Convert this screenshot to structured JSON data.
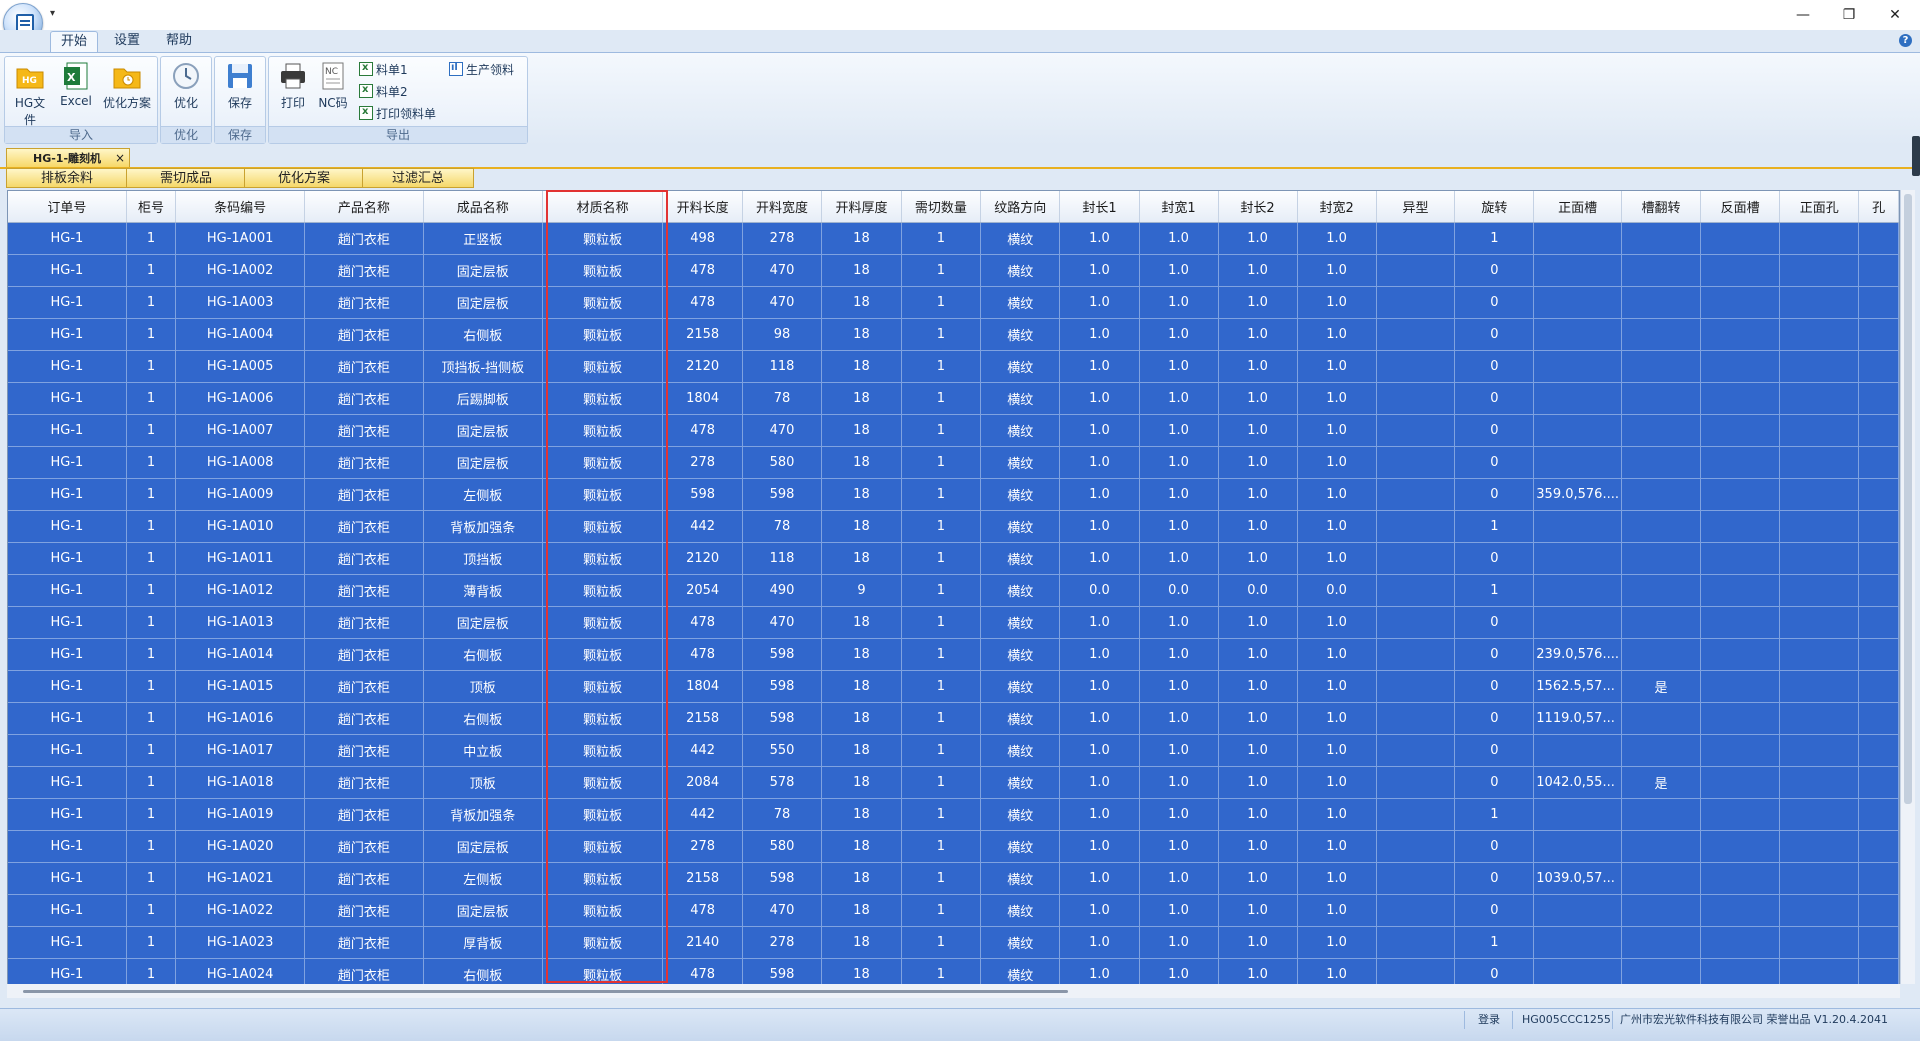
{
  "qat": {
    "glyph": "▾"
  },
  "window": {
    "minimize": "—",
    "restore": "❐",
    "close": "✕"
  },
  "ribbon": {
    "tabs": [
      "开始",
      "设置",
      "帮助"
    ],
    "active_tab": "开始",
    "help": "?",
    "groups": {
      "import": {
        "label": "导入",
        "hg_file": "HG文件",
        "excel": "Excel",
        "opt_plan": "优化方案"
      },
      "optimize": {
        "label": "优化",
        "optimize": "优化"
      },
      "save": {
        "label": "保存",
        "save": "保存"
      },
      "export": {
        "label": "导出",
        "print": "打印",
        "nc": "NC码",
        "list1": "料单1",
        "list2": "料单2",
        "print_pick": "打印领料单",
        "prod_pick": "生产领料"
      }
    }
  },
  "doc_tab": {
    "title": "HG-1-雕刻机",
    "close": "×"
  },
  "subtabs": [
    "排板余料",
    "需切成品",
    "优化方案",
    "过滤汇总"
  ],
  "grid": {
    "columns": [
      "订单号",
      "柜号",
      "条码编号",
      "产品名称",
      "成品名称",
      "材质名称",
      "开料长度",
      "开料宽度",
      "开料厚度",
      "需切数量",
      "纹路方向",
      "封长1",
      "封宽1",
      "封长2",
      "封宽2",
      "异型",
      "旋转",
      "正面槽",
      "槽翻转",
      "反面槽",
      "正面孔",
      "孔"
    ],
    "rows": [
      [
        "HG-1",
        "1",
        "HG-1A001",
        "趟门衣柜",
        "正竖板",
        "颗粒板",
        "498",
        "278",
        "18",
        "1",
        "横纹",
        "1.0",
        "1.0",
        "1.0",
        "1.0",
        "",
        "1",
        "",
        "",
        "",
        "",
        ""
      ],
      [
        "HG-1",
        "1",
        "HG-1A002",
        "趟门衣柜",
        "固定层板",
        "颗粒板",
        "478",
        "470",
        "18",
        "1",
        "横纹",
        "1.0",
        "1.0",
        "1.0",
        "1.0",
        "",
        "0",
        "",
        "",
        "",
        "",
        ""
      ],
      [
        "HG-1",
        "1",
        "HG-1A003",
        "趟门衣柜",
        "固定层板",
        "颗粒板",
        "478",
        "470",
        "18",
        "1",
        "横纹",
        "1.0",
        "1.0",
        "1.0",
        "1.0",
        "",
        "0",
        "",
        "",
        "",
        "",
        ""
      ],
      [
        "HG-1",
        "1",
        "HG-1A004",
        "趟门衣柜",
        "右侧板",
        "颗粒板",
        "2158",
        "98",
        "18",
        "1",
        "横纹",
        "1.0",
        "1.0",
        "1.0",
        "1.0",
        "",
        "0",
        "",
        "",
        "",
        "",
        ""
      ],
      [
        "HG-1",
        "1",
        "HG-1A005",
        "趟门衣柜",
        "顶挡板-挡侧板",
        "颗粒板",
        "2120",
        "118",
        "18",
        "1",
        "横纹",
        "1.0",
        "1.0",
        "1.0",
        "1.0",
        "",
        "0",
        "",
        "",
        "",
        "",
        ""
      ],
      [
        "HG-1",
        "1",
        "HG-1A006",
        "趟门衣柜",
        "后踢脚板",
        "颗粒板",
        "1804",
        "78",
        "18",
        "1",
        "横纹",
        "1.0",
        "1.0",
        "1.0",
        "1.0",
        "",
        "0",
        "",
        "",
        "",
        "",
        ""
      ],
      [
        "HG-1",
        "1",
        "HG-1A007",
        "趟门衣柜",
        "固定层板",
        "颗粒板",
        "478",
        "470",
        "18",
        "1",
        "横纹",
        "1.0",
        "1.0",
        "1.0",
        "1.0",
        "",
        "0",
        "",
        "",
        "",
        "",
        ""
      ],
      [
        "HG-1",
        "1",
        "HG-1A008",
        "趟门衣柜",
        "固定层板",
        "颗粒板",
        "278",
        "580",
        "18",
        "1",
        "横纹",
        "1.0",
        "1.0",
        "1.0",
        "1.0",
        "",
        "0",
        "",
        "",
        "",
        "",
        ""
      ],
      [
        "HG-1",
        "1",
        "HG-1A009",
        "趟门衣柜",
        "左侧板",
        "颗粒板",
        "598",
        "598",
        "18",
        "1",
        "横纹",
        "1.0",
        "1.0",
        "1.0",
        "1.0",
        "",
        "0",
        "359.0,576....",
        "",
        "",
        "",
        ""
      ],
      [
        "HG-1",
        "1",
        "HG-1A010",
        "趟门衣柜",
        "背板加强条",
        "颗粒板",
        "442",
        "78",
        "18",
        "1",
        "横纹",
        "1.0",
        "1.0",
        "1.0",
        "1.0",
        "",
        "1",
        "",
        "",
        "",
        "",
        ""
      ],
      [
        "HG-1",
        "1",
        "HG-1A011",
        "趟门衣柜",
        "顶挡板",
        "颗粒板",
        "2120",
        "118",
        "18",
        "1",
        "横纹",
        "1.0",
        "1.0",
        "1.0",
        "1.0",
        "",
        "0",
        "",
        "",
        "",
        "",
        ""
      ],
      [
        "HG-1",
        "1",
        "HG-1A012",
        "趟门衣柜",
        "薄背板",
        "颗粒板",
        "2054",
        "490",
        "9",
        "1",
        "横纹",
        "0.0",
        "0.0",
        "0.0",
        "0.0",
        "",
        "1",
        "",
        "",
        "",
        "",
        ""
      ],
      [
        "HG-1",
        "1",
        "HG-1A013",
        "趟门衣柜",
        "固定层板",
        "颗粒板",
        "478",
        "470",
        "18",
        "1",
        "横纹",
        "1.0",
        "1.0",
        "1.0",
        "1.0",
        "",
        "0",
        "",
        "",
        "",
        "",
        ""
      ],
      [
        "HG-1",
        "1",
        "HG-1A014",
        "趟门衣柜",
        "右侧板",
        "颗粒板",
        "478",
        "598",
        "18",
        "1",
        "横纹",
        "1.0",
        "1.0",
        "1.0",
        "1.0",
        "",
        "0",
        "239.0,576....",
        "",
        "",
        "",
        ""
      ],
      [
        "HG-1",
        "1",
        "HG-1A015",
        "趟门衣柜",
        "顶板",
        "颗粒板",
        "1804",
        "598",
        "18",
        "1",
        "横纹",
        "1.0",
        "1.0",
        "1.0",
        "1.0",
        "",
        "0",
        "1562.5,57...",
        "是",
        "",
        "",
        ""
      ],
      [
        "HG-1",
        "1",
        "HG-1A016",
        "趟门衣柜",
        "右侧板",
        "颗粒板",
        "2158",
        "598",
        "18",
        "1",
        "横纹",
        "1.0",
        "1.0",
        "1.0",
        "1.0",
        "",
        "0",
        "1119.0,57...",
        "",
        "",
        "",
        ""
      ],
      [
        "HG-1",
        "1",
        "HG-1A017",
        "趟门衣柜",
        "中立板",
        "颗粒板",
        "442",
        "550",
        "18",
        "1",
        "横纹",
        "1.0",
        "1.0",
        "1.0",
        "1.0",
        "",
        "0",
        "",
        "",
        "",
        "",
        ""
      ],
      [
        "HG-1",
        "1",
        "HG-1A018",
        "趟门衣柜",
        "顶板",
        "颗粒板",
        "2084",
        "578",
        "18",
        "1",
        "横纹",
        "1.0",
        "1.0",
        "1.0",
        "1.0",
        "",
        "0",
        "1042.0,55...",
        "是",
        "",
        "",
        ""
      ],
      [
        "HG-1",
        "1",
        "HG-1A019",
        "趟门衣柜",
        "背板加强条",
        "颗粒板",
        "442",
        "78",
        "18",
        "1",
        "横纹",
        "1.0",
        "1.0",
        "1.0",
        "1.0",
        "",
        "1",
        "",
        "",
        "",
        "",
        ""
      ],
      [
        "HG-1",
        "1",
        "HG-1A020",
        "趟门衣柜",
        "固定层板",
        "颗粒板",
        "278",
        "580",
        "18",
        "1",
        "横纹",
        "1.0",
        "1.0",
        "1.0",
        "1.0",
        "",
        "0",
        "",
        "",
        "",
        "",
        ""
      ],
      [
        "HG-1",
        "1",
        "HG-1A021",
        "趟门衣柜",
        "左侧板",
        "颗粒板",
        "2158",
        "598",
        "18",
        "1",
        "横纹",
        "1.0",
        "1.0",
        "1.0",
        "1.0",
        "",
        "0",
        "1039.0,57...",
        "",
        "",
        "",
        ""
      ],
      [
        "HG-1",
        "1",
        "HG-1A022",
        "趟门衣柜",
        "固定层板",
        "颗粒板",
        "478",
        "470",
        "18",
        "1",
        "横纹",
        "1.0",
        "1.0",
        "1.0",
        "1.0",
        "",
        "0",
        "",
        "",
        "",
        "",
        ""
      ],
      [
        "HG-1",
        "1",
        "HG-1A023",
        "趟门衣柜",
        "厚背板",
        "颗粒板",
        "2140",
        "278",
        "18",
        "1",
        "横纹",
        "1.0",
        "1.0",
        "1.0",
        "1.0",
        "",
        "1",
        "",
        "",
        "",
        "",
        ""
      ],
      [
        "HG-1",
        "1",
        "HG-1A024",
        "趟门衣柜",
        "右侧板",
        "颗粒板",
        "478",
        "598",
        "18",
        "1",
        "横纹",
        "1.0",
        "1.0",
        "1.0",
        "1.0",
        "",
        "0",
        "",
        "",
        "",
        "",
        ""
      ]
    ]
  },
  "status": {
    "login": "登录",
    "machine_code": "HG005CCC1255",
    "company": "广州市宏光软件科技有限公司 荣誉出品 V1.20.4.2041"
  },
  "colors": {
    "grid_bg": "#3167cc",
    "highlight": "#e23333",
    "tab_active": "#f7d868"
  }
}
